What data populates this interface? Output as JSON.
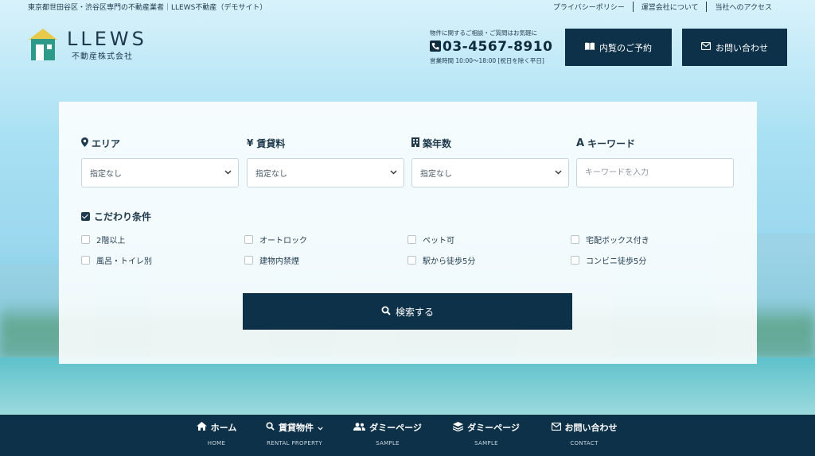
{
  "topbar": {
    "tagline": "東京都世田谷区・渋谷区専門の不動産業者｜LLEWS不動産（デモサイト）",
    "links": [
      "プライバシーポリシー",
      "運営会社について",
      "当社へのアクセス"
    ]
  },
  "logo": {
    "name": "LLEWS",
    "sub": "不動産株式会社"
  },
  "contact": {
    "lead": "物件に関するご相談・ご質問はお気軽に",
    "phone": "03-4567-8910",
    "hours": "営業時間 10:00〜18:00 [祝日を除く平日]"
  },
  "header_buttons": {
    "reserve": "内覧のご予約",
    "inquiry": "お問い合わせ"
  },
  "search": {
    "fields": [
      {
        "label": "エリア",
        "icon": "map-pin-icon",
        "value": "指定なし"
      },
      {
        "label": "賃貸料",
        "icon": "yen-icon",
        "value": "指定なし"
      },
      {
        "label": "築年数",
        "icon": "building-icon",
        "value": "指定なし"
      },
      {
        "label": "キーワード",
        "icon": "font-icon",
        "placeholder": "キーワードを入力"
      }
    ],
    "conditions_title": "こだわり条件",
    "conditions": [
      "2階以上",
      "オートロック",
      "ペット可",
      "宅配ボックス付き",
      "風呂・トイレ別",
      "建物内禁煙",
      "駅から徒歩5分",
      "コンビニ徒歩5分"
    ],
    "submit": "検索する"
  },
  "nav": [
    {
      "label": "ホーム",
      "sub": "HOME",
      "icon": "home-icon"
    },
    {
      "label": "賃貸物件",
      "sub": "RENTAL PROPERTY",
      "icon": "search-icon"
    },
    {
      "label": "ダミーページ",
      "sub": "SAMPLE",
      "icon": "users-icon"
    },
    {
      "label": "ダミーページ",
      "sub": "SAMPLE",
      "icon": "layers-icon"
    },
    {
      "label": "お問い合わせ",
      "sub": "CONTACT",
      "icon": "envelope-icon"
    }
  ],
  "colors": {
    "navy": "#0d3148",
    "text": "#1f3a4d",
    "logo_green": "#2e9a8a",
    "logo_yellow": "#e9c94a"
  }
}
